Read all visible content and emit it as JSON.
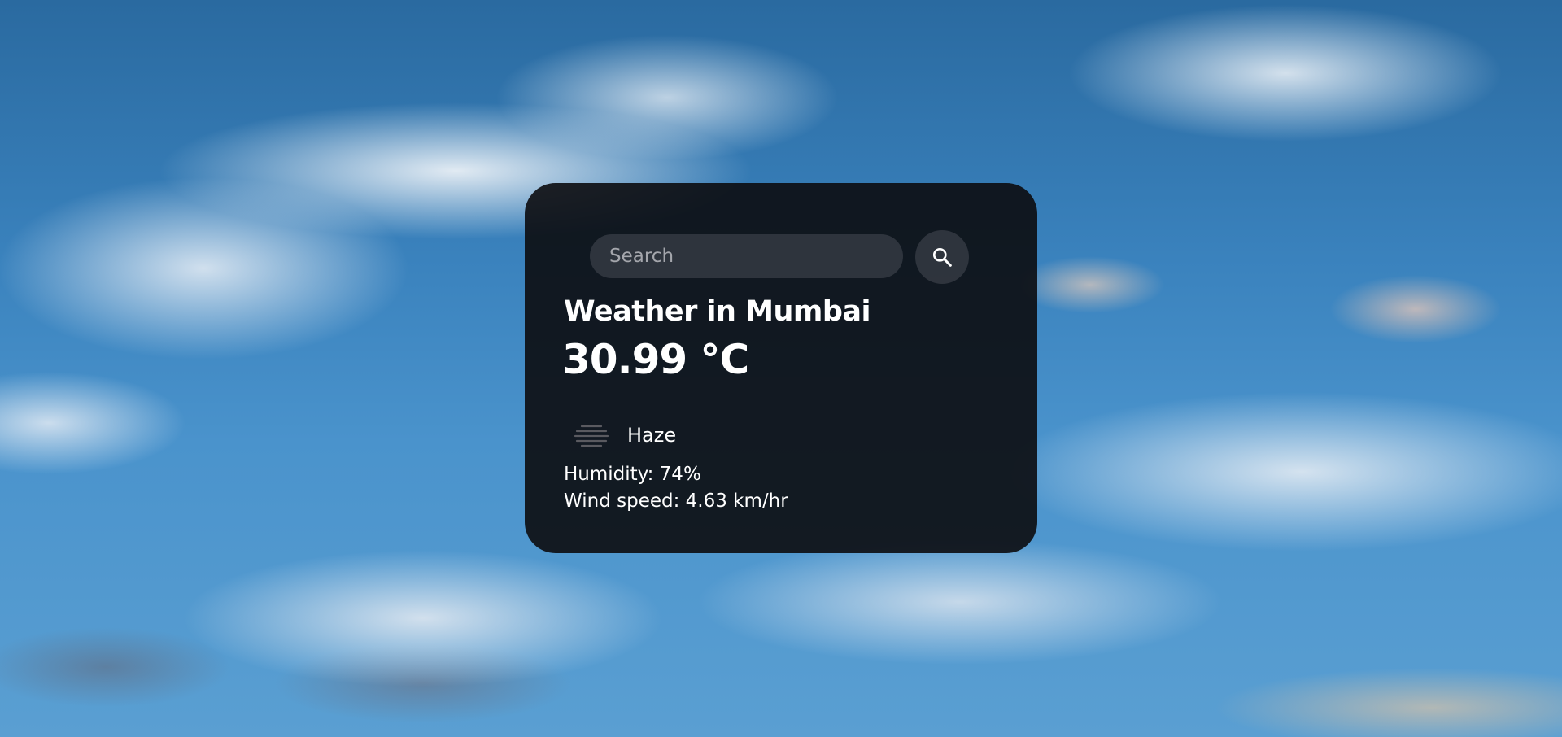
{
  "search": {
    "placeholder": "Search"
  },
  "weather": {
    "city_title": "Weather in Mumbai",
    "temperature": "30.99 °C",
    "condition": "Haze",
    "condition_icon": "haze-icon",
    "humidity": "Humidity: 74%",
    "wind": "Wind speed: 4.63 km/hr"
  },
  "icons": {
    "search": "search-icon"
  },
  "colors": {
    "card_background": "#0c0c10",
    "text": "#ffffff",
    "sky": "#3a82bd"
  }
}
